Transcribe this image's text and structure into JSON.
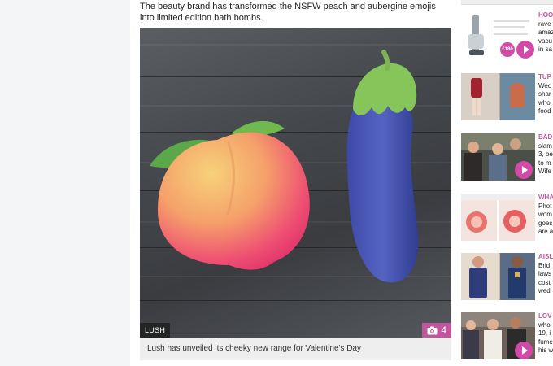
{
  "article": {
    "standfirst": "The beauty brand has transformed the NSFW peach and aubergine emojis into limited edition bath bombs.",
    "image": {
      "credit": "LUSH",
      "gallery_count": "4",
      "caption": "Lush has unveiled its cheeky new range for Valentine's Day"
    }
  },
  "sidebar": {
    "items": [
      {
        "kicker": "HOO",
        "lines": [
          "rave",
          "amaz",
          "vacu",
          "in sa"
        ],
        "price": "£180",
        "has_play": true,
        "thumb": "vacuum"
      },
      {
        "kicker": "TUP",
        "lines": [
          "Wed",
          "shar",
          "who",
          "food"
        ],
        "has_play": false,
        "thumb": "people-outfits"
      },
      {
        "kicker": "BAD",
        "lines": [
          "slam",
          "3, be",
          "to m",
          "Wife"
        ],
        "has_play": true,
        "thumb": "family-selfie"
      },
      {
        "kicker": "WHA",
        "lines": [
          "Phot",
          "wom",
          "goes",
          "are a"
        ],
        "has_play": false,
        "thumb": "flowers"
      },
      {
        "kicker": "AISL",
        "lines": [
          "Brid",
          "laws",
          "cost",
          "wed"
        ],
        "has_play": false,
        "thumb": "costumes"
      },
      {
        "kicker": "LOV",
        "lines": [
          "who",
          "19, i",
          "fume",
          "his w"
        ],
        "has_play": true,
        "thumb": "couple"
      }
    ]
  },
  "colors": {
    "accent": "#c0569d",
    "play": "#d24aa7"
  },
  "icons": {
    "gallery": "camera-icon",
    "play": "play-icon"
  }
}
